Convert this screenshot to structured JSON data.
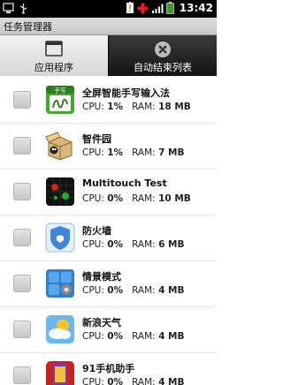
{
  "status_bar": {
    "time": "13:42",
    "icons": [
      "monitor-icon",
      "usb-icon",
      "battery-alert-icon",
      "red-cross-icon",
      "signal-icon",
      "battery-icon"
    ]
  },
  "title_bar": {
    "title": "任务管理器"
  },
  "tabs": [
    {
      "label": "应用程序",
      "icon": "window-icon",
      "active": true
    },
    {
      "label": "自动结束列表",
      "icon": "close-circle-icon",
      "active": false
    }
  ],
  "labels": {
    "cpu": "CPU:",
    "ram": "RAM:"
  },
  "apps": [
    {
      "name": "全屏智能手写输入法",
      "cpu": "1%",
      "ram": "18 MB",
      "icon": "handwriting-app-icon"
    },
    {
      "name": "智件园",
      "cpu": "1%",
      "ram": "7 MB",
      "icon": "box-app-icon"
    },
    {
      "name": "Multitouch Test",
      "cpu": "0%",
      "ram": "10 MB",
      "icon": "multitouch-app-icon"
    },
    {
      "name": "防火墙",
      "cpu": "0%",
      "ram": "6 MB",
      "icon": "firewall-app-icon"
    },
    {
      "name": "情景模式",
      "cpu": "0%",
      "ram": "4 MB",
      "icon": "profile-app-icon"
    },
    {
      "name": "新浪天气",
      "cpu": "0%",
      "ram": "4 MB",
      "icon": "weather-app-icon"
    },
    {
      "name": "91手机助手",
      "cpu": "0%",
      "ram": "4 MB",
      "icon": "phone-assistant-app-icon"
    }
  ],
  "colors": {
    "accent_green": "#3a9a2a",
    "alert_red": "#e02020"
  }
}
